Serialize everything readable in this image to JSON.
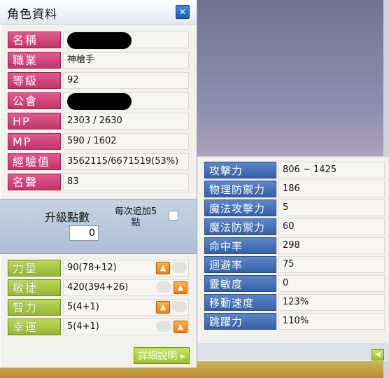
{
  "window": {
    "title": "角色資料",
    "close_icon": "close-icon"
  },
  "profile": [
    {
      "label": "名稱",
      "value": ""
    },
    {
      "label": "職業",
      "value": "神槍手"
    },
    {
      "label": "等級",
      "value": "92"
    },
    {
      "label": "公會",
      "value": ""
    },
    {
      "label": "HP",
      "value": "2303 / 2630"
    },
    {
      "label": "MP",
      "value": "590 / 1602"
    },
    {
      "label": "經驗值",
      "value": "3562115/6671519(53%)"
    },
    {
      "label": "名聲",
      "value": "83"
    }
  ],
  "level_up": {
    "label": "升級點數",
    "points": "0",
    "add5_label": "每次追加5點"
  },
  "stats": [
    {
      "label": "力量",
      "value": "90(78+12)"
    },
    {
      "label": "敏捷",
      "value": "420(394+26)"
    },
    {
      "label": "智力",
      "value": "5(4+1)"
    },
    {
      "label": "幸運",
      "value": "5(4+1)"
    }
  ],
  "detail_button": "詳細說明",
  "details": [
    {
      "label": "攻擊力",
      "value": "806 ~ 1425"
    },
    {
      "label": "物理防禦力",
      "value": "186"
    },
    {
      "label": "魔法攻擊力",
      "value": "5"
    },
    {
      "label": "魔法防禦力",
      "value": "60"
    },
    {
      "label": "命中率",
      "value": "298"
    },
    {
      "label": "迴避率",
      "value": "75"
    },
    {
      "label": "靈敏度",
      "value": "0"
    },
    {
      "label": "移動速度",
      "value": "123%"
    },
    {
      "label": "跳躍力",
      "value": "110%"
    }
  ]
}
